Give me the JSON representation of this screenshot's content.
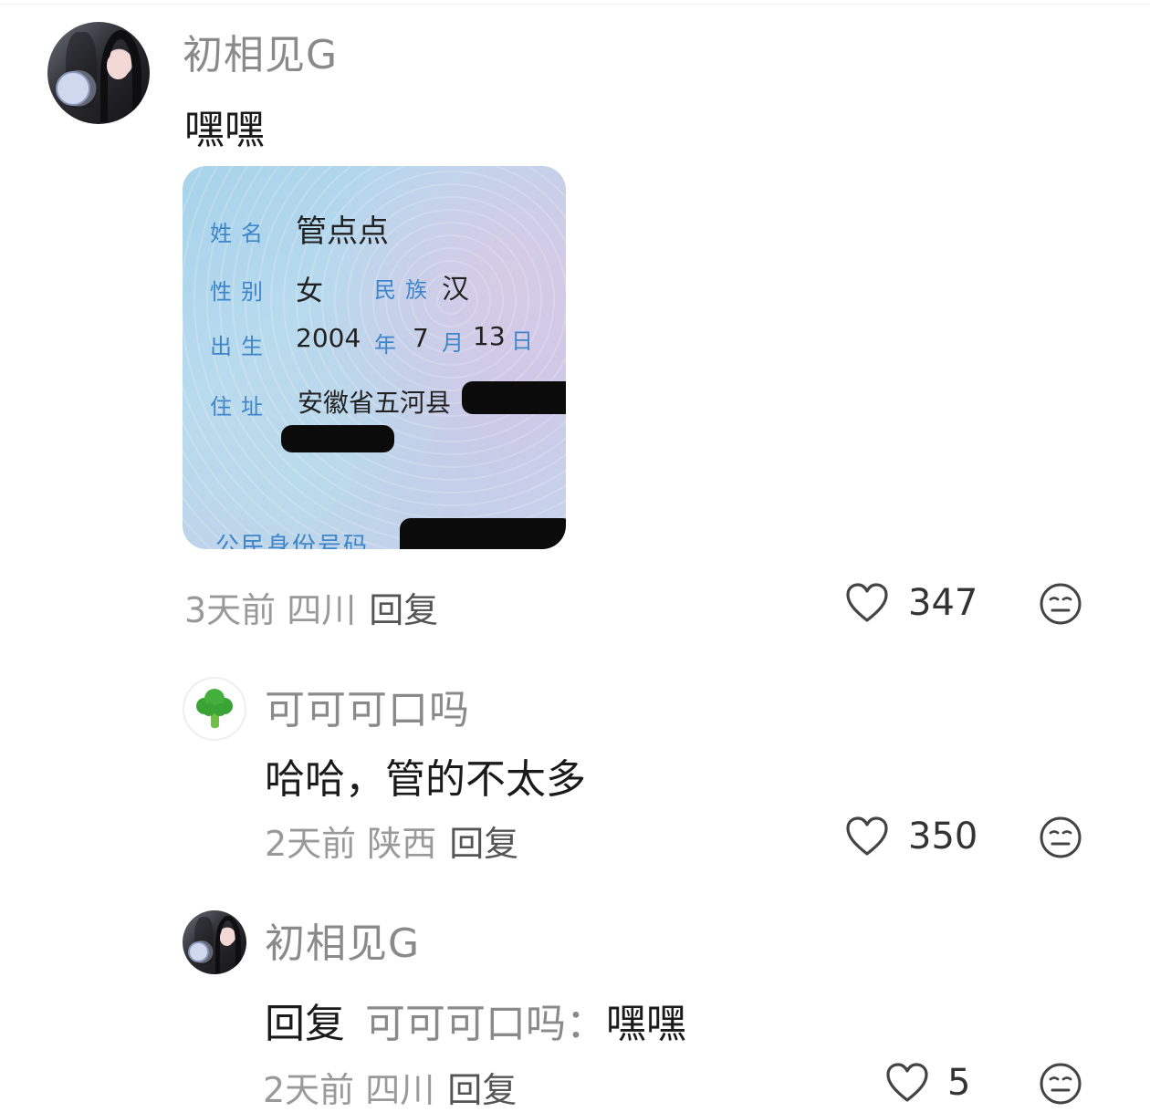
{
  "comments": [
    {
      "username": "初相见G",
      "text": "嘿嘿",
      "time": "3天前",
      "location": "四川",
      "reply_label": "回复",
      "likes": "347",
      "image": {
        "name_label": "姓名",
        "name_value": "管点点",
        "gender_label": "性别",
        "gender_value": "女",
        "ethnicity_label": "民族",
        "ethnicity_value": "汉",
        "birth_label": "出生",
        "birth_year": "2004",
        "year_char": "年",
        "birth_month": "7",
        "month_char": "月",
        "birth_day": "13",
        "day_char": "日",
        "address_label": "住址",
        "address_value": "安徽省五河县",
        "id_label": "公民身份号码"
      }
    },
    {
      "username": "可可可口吗",
      "text": "哈哈，管的不太多",
      "time": "2天前",
      "location": "陕西",
      "reply_label": "回复",
      "likes": "350"
    },
    {
      "username": "初相见G",
      "reply_prefix": "回复",
      "reply_target": "可可可口吗：",
      "text": "嘿嘿",
      "time": "2天前",
      "location": "四川",
      "reply_label": "回复",
      "likes": "5"
    }
  ],
  "icons": {
    "like": "heart-outline-icon",
    "dislike": "meh-face-icon",
    "broccoli_avatar": "broccoli-icon"
  },
  "colors": {
    "username": "#8a8a8a",
    "meta": "#999999",
    "text": "#1a1a1a"
  }
}
